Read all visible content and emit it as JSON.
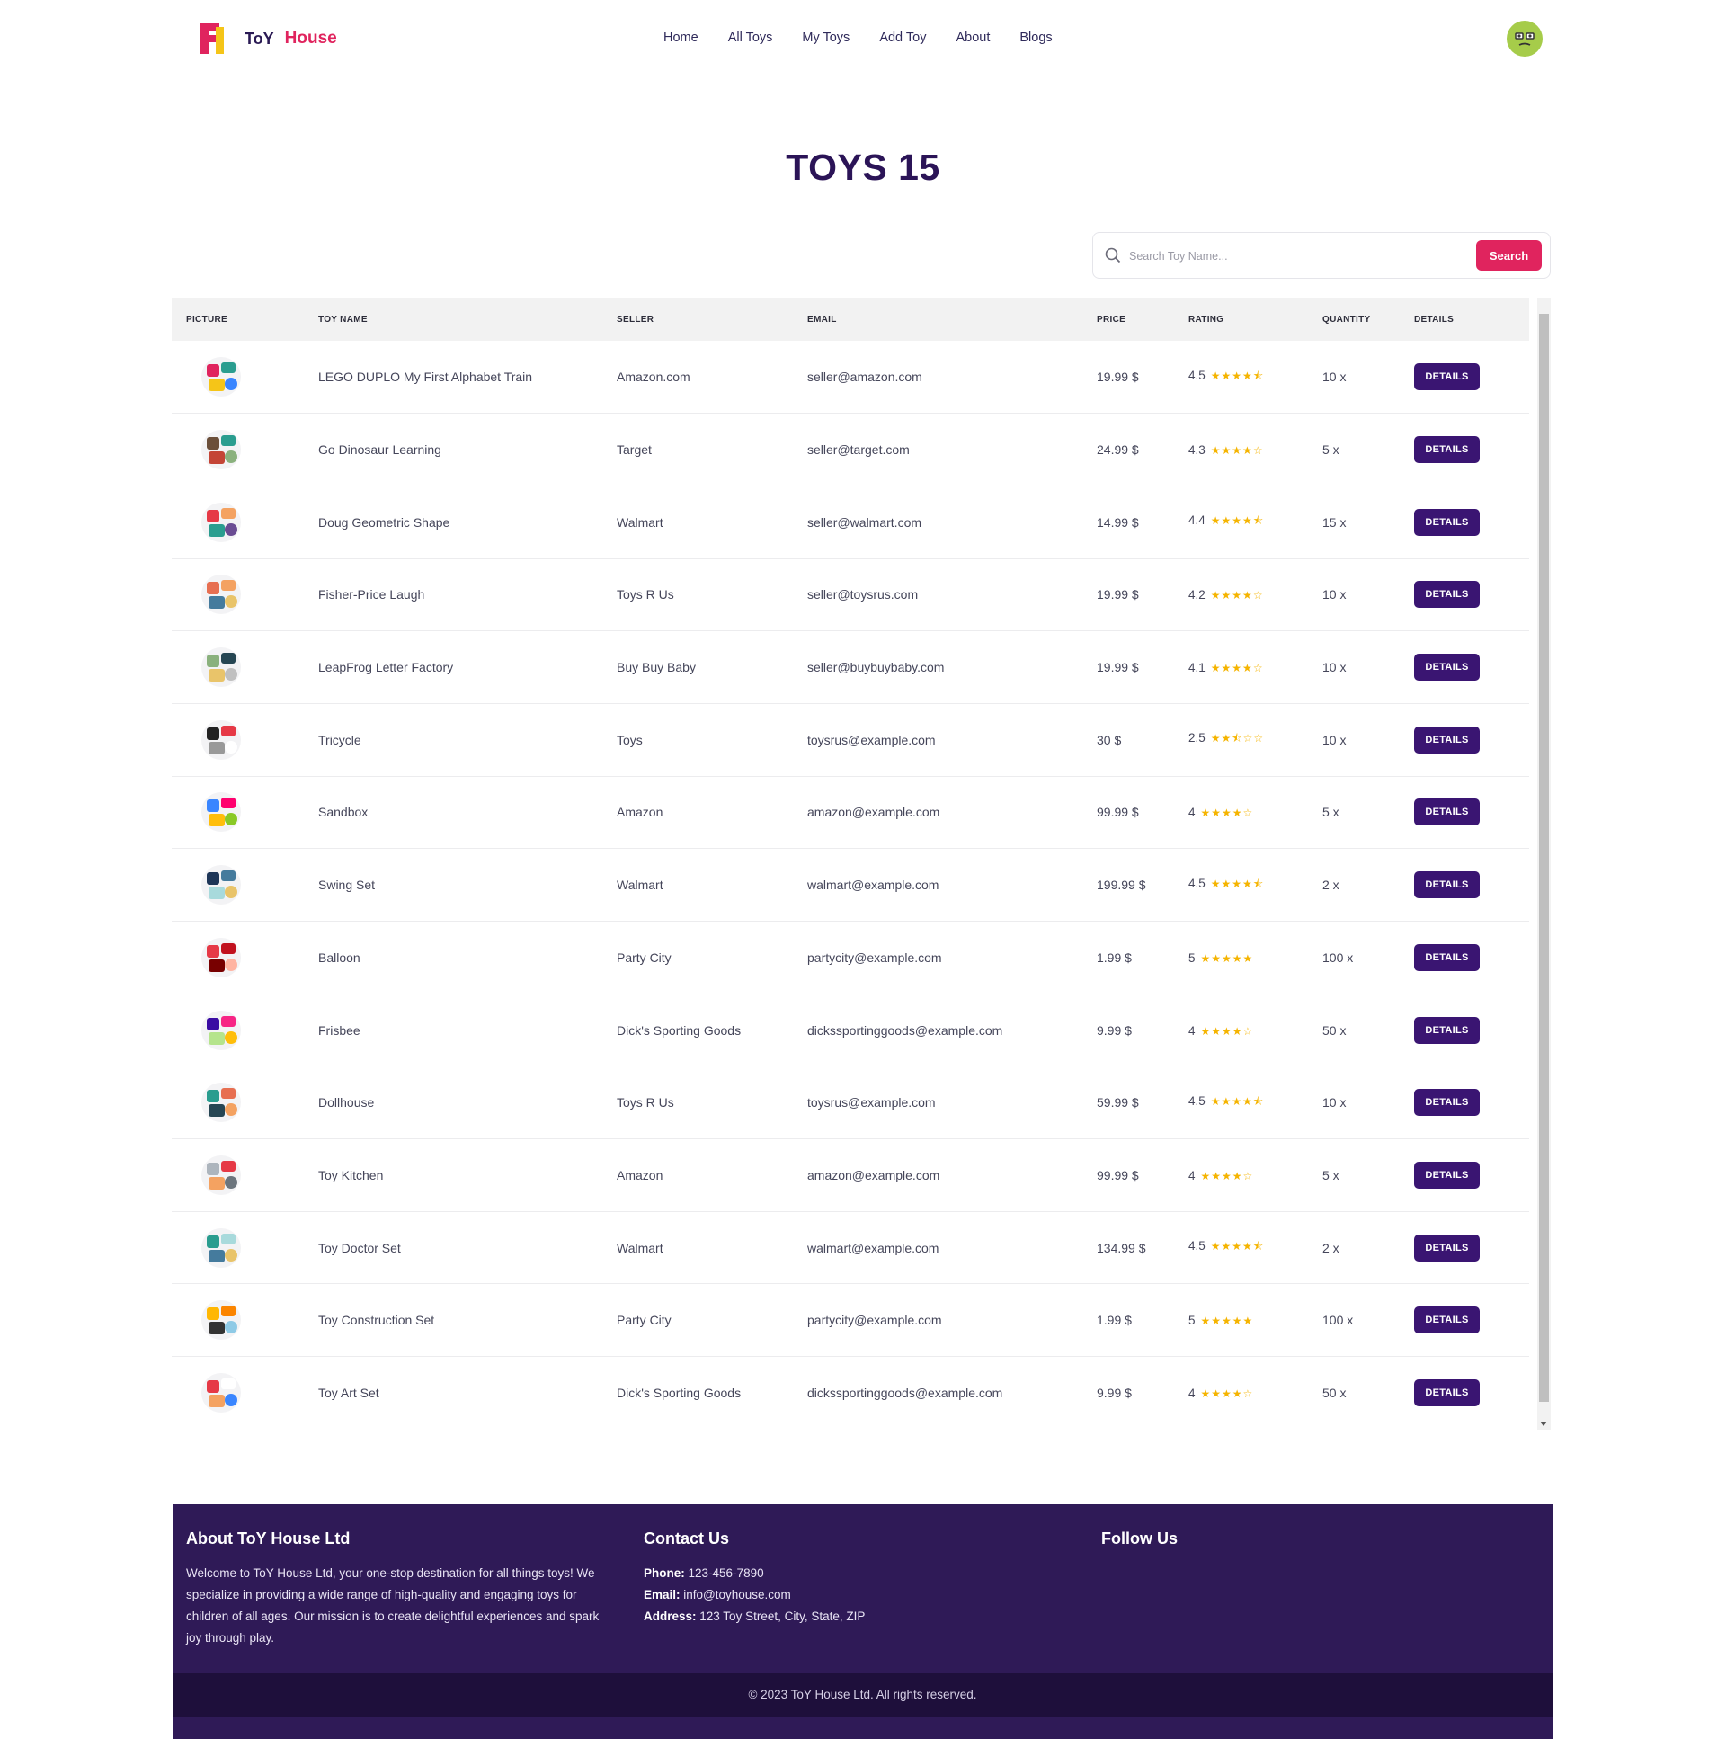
{
  "brand": {
    "name_part1": "ToY",
    "name_part2": "House"
  },
  "nav": {
    "links": [
      "Home",
      "All Toys",
      "My Toys",
      "Add Toy",
      "About",
      "Blogs"
    ]
  },
  "page_title": "TOYS 15",
  "search": {
    "placeholder": "Search Toy Name...",
    "button_label": "Search"
  },
  "table": {
    "headers": [
      "PICTURE",
      "TOY NAME",
      "SELLER",
      "EMAIL",
      "PRICE",
      "RATING",
      "QUANTITY",
      "DETAILS"
    ],
    "button_label": "DETAILS",
    "rows": [
      {
        "name": "LEGO DUPLO My First Alphabet Train",
        "seller": "Amazon.com",
        "email": "seller@amazon.com",
        "price": "19.99 $",
        "rating": "4.5",
        "stars": "★★★★⯪",
        "qty": "10 x"
      },
      {
        "name": "Go Dinosaur Learning",
        "seller": "Target",
        "email": "seller@target.com",
        "price": "24.99 $",
        "rating": "4.3",
        "stars": "★★★★☆",
        "qty": "5 x"
      },
      {
        "name": "Doug Geometric Shape",
        "seller": "Walmart",
        "email": "seller@walmart.com",
        "price": "14.99 $",
        "rating": "4.4",
        "stars": "★★★★⯪",
        "qty": "15 x"
      },
      {
        "name": "Fisher-Price Laugh",
        "seller": "Toys R Us",
        "email": "seller@toysrus.com",
        "price": "19.99 $",
        "rating": "4.2",
        "stars": "★★★★☆",
        "qty": "10 x"
      },
      {
        "name": "LeapFrog Letter Factory",
        "seller": "Buy Buy Baby",
        "email": "seller@buybuybaby.com",
        "price": "19.99 $",
        "rating": "4.1",
        "stars": "★★★★☆",
        "qty": "10 x"
      },
      {
        "name": "Tricycle",
        "seller": "Toys",
        "email": "toysrus@example.com",
        "price": "30 $",
        "rating": "2.5",
        "stars": "★★⯪☆☆",
        "qty": "10 x"
      },
      {
        "name": "Sandbox",
        "seller": "Amazon",
        "email": "amazon@example.com",
        "price": "99.99 $",
        "rating": "4",
        "stars": "★★★★☆",
        "qty": "5 x"
      },
      {
        "name": "Swing Set",
        "seller": "Walmart",
        "email": "walmart@example.com",
        "price": "199.99 $",
        "rating": "4.5",
        "stars": "★★★★⯪",
        "qty": "2 x"
      },
      {
        "name": "Balloon",
        "seller": "Party City",
        "email": "partycity@example.com",
        "price": "1.99 $",
        "rating": "5",
        "stars": "★★★★★",
        "qty": "100 x"
      },
      {
        "name": "Frisbee",
        "seller": "Dick's Sporting Goods",
        "email": "dickssportinggoods@example.com",
        "price": "9.99 $",
        "rating": "4",
        "stars": "★★★★☆",
        "qty": "50 x"
      },
      {
        "name": "Dollhouse",
        "seller": "Toys R Us",
        "email": "toysrus@example.com",
        "price": "59.99 $",
        "rating": "4.5",
        "stars": "★★★★⯪",
        "qty": "10 x"
      },
      {
        "name": "Toy Kitchen",
        "seller": "Amazon",
        "email": "amazon@example.com",
        "price": "99.99 $",
        "rating": "4",
        "stars": "★★★★☆",
        "qty": "5 x"
      },
      {
        "name": "Toy Doctor Set",
        "seller": "Walmart",
        "email": "walmart@example.com",
        "price": "134.99 $",
        "rating": "4.5",
        "stars": "★★★★⯪",
        "qty": "2 x"
      },
      {
        "name": "Toy Construction Set",
        "seller": "Party City",
        "email": "partycity@example.com",
        "price": "1.99 $",
        "rating": "5",
        "stars": "★★★★★",
        "qty": "100 x"
      },
      {
        "name": "Toy Art Set",
        "seller": "Dick's Sporting Goods",
        "email": "dickssportinggoods@example.com",
        "price": "9.99 $",
        "rating": "4",
        "stars": "★★★★☆",
        "qty": "50 x"
      }
    ]
  },
  "footer": {
    "about_title": "About ToY House Ltd",
    "about_text": "Welcome to ToY House Ltd, your one-stop destination for all things toys! We specialize in providing a wide range of high-quality and engaging toys for children of all ages. Our mission is to create delightful experiences and spark joy through play.",
    "contact_title": "Contact Us",
    "phone_label": "Phone:",
    "phone": "123-456-7890",
    "email_label": "Email:",
    "email": "info@toyhouse.com",
    "address_label": "Address:",
    "address": "123 Toy Street, City, State, ZIP",
    "follow_title": "Follow Us",
    "copyright": "© 2023 ToY House Ltd. All rights reserved."
  },
  "colors": {
    "accent": "#e0245e",
    "primary": "#3a1572",
    "footer_bg": "#2f1a57",
    "star": "#f5b400"
  }
}
